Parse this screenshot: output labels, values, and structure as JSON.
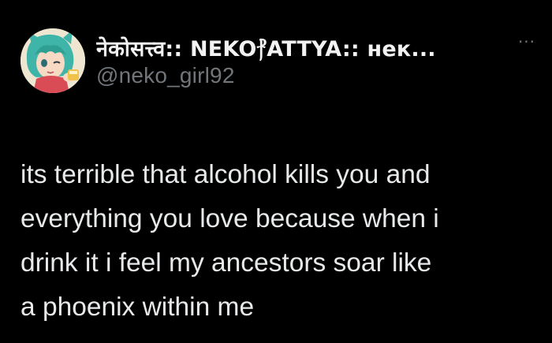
{
  "author": {
    "display_name": "नेकोसत्त्व:: NEKO⳨ATTYA:: нек...",
    "handle": "@neko_girl92",
    "avatar_icon": "anime-girl-avatar"
  },
  "header": {
    "more_icon": "more-options-icon",
    "more_glyph": "···"
  },
  "tweet": {
    "text": "its terrible that alcohol kills you and\neverything you love because when i\ndrink it i feel my ancestors soar like\na phoenix within me"
  },
  "colors": {
    "background": "#000000",
    "primary_text": "#e7e9ea",
    "secondary_text": "#71767b"
  }
}
